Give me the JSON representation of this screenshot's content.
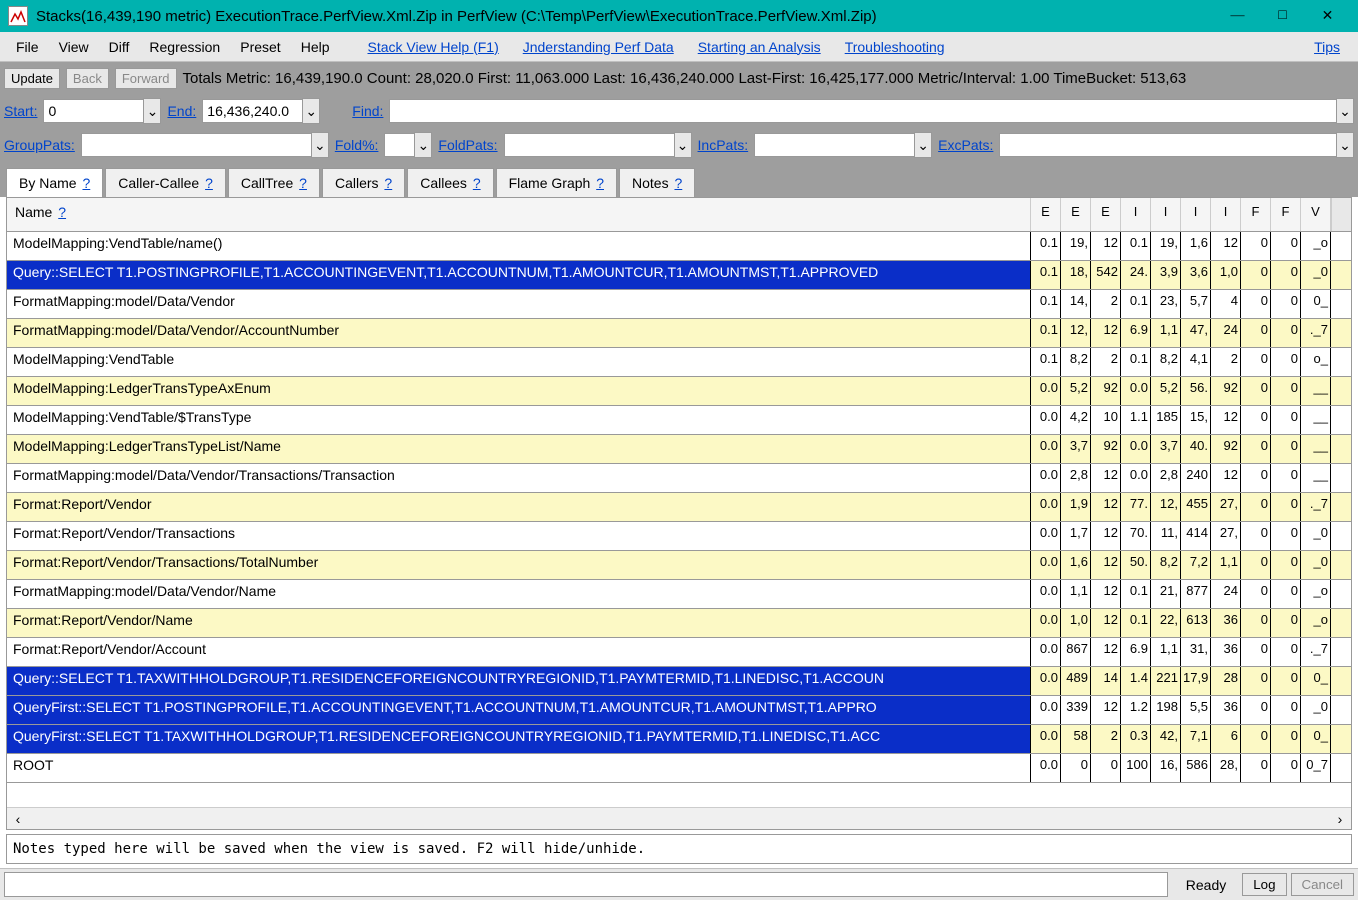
{
  "titlebar": {
    "title": "Stacks(16,439,190 metric) ExecutionTrace.PerfView.Xml.Zip in PerfView (C:\\Temp\\PerfView\\ExecutionTrace.PerfView.Xml.Zip)"
  },
  "menu": {
    "file": "File",
    "view": "View",
    "diff": "Diff",
    "regression": "Regression",
    "preset": "Preset",
    "help": "Help",
    "link_stack_view_help": "Stack View Help (F1)",
    "link_understanding": "Jnderstanding Perf Data",
    "link_starting": "Starting an Analysis",
    "link_troubleshooting": "Troubleshooting",
    "link_tips": "Tips"
  },
  "toolbar1": {
    "update": "Update",
    "back": "Back",
    "forward": "Forward",
    "totals": "Totals Metric: 16,439,190.0  Count: 28,020.0  First: 11,063.000 Last: 16,436,240.000  Last-First: 16,425,177.000  Metric/Interval: 1.00  TimeBucket: 513,63"
  },
  "toolbar2": {
    "start_label": "Start:",
    "start_value": "0",
    "end_label": "End:",
    "end_value": "16,436,240.0",
    "find_label": "Find:",
    "find_value": ""
  },
  "toolbar3": {
    "grouppats_label": "GroupPats:",
    "foldpct_label": "Fold%:",
    "foldpats_label": "FoldPats:",
    "incpats_label": "IncPats:",
    "excpats_label": "ExcPats:"
  },
  "tabs": {
    "byname": "By Name",
    "callercallee": "Caller-Callee",
    "calltree": "CallTree",
    "callers": "Callers",
    "callees": "Callees",
    "flamegraph": "Flame Graph",
    "notes": "Notes",
    "help": "?"
  },
  "table": {
    "col_name": "Name",
    "col_help": "?",
    "cols": [
      "E",
      "E",
      "E",
      "I",
      "I",
      "I",
      "I",
      "F",
      "F",
      "V"
    ],
    "rows": [
      {
        "name": "ModelMapping:VendTable/name()",
        "cells": [
          "0.1",
          "19,",
          "12",
          "0.1",
          "19,",
          "1,6",
          "12",
          "0",
          "0",
          "_o"
        ],
        "alt": false,
        "hl": false
      },
      {
        "name": "Query::SELECT T1.POSTINGPROFILE,T1.ACCOUNTINGEVENT,T1.ACCOUNTNUM,T1.AMOUNTCUR,T1.AMOUNTMST,T1.APPROVED",
        "cells": [
          "0.1",
          "18,",
          "542",
          "24.",
          "3,9",
          "3,6",
          "1,0",
          "0",
          "0",
          "_0"
        ],
        "alt": true,
        "hl": true
      },
      {
        "name": "FormatMapping:model/Data/Vendor",
        "cells": [
          "0.1",
          "14,",
          "2",
          "0.1",
          "23,",
          "5,7",
          "4",
          "0",
          "0",
          "0_"
        ],
        "alt": false,
        "hl": false
      },
      {
        "name": "FormatMapping:model/Data/Vendor/AccountNumber",
        "cells": [
          "0.1",
          "12,",
          "12",
          "6.9",
          "1,1",
          "47,",
          "24",
          "0",
          "0",
          "._7"
        ],
        "alt": true,
        "hl": false
      },
      {
        "name": "ModelMapping:VendTable",
        "cells": [
          "0.1",
          "8,2",
          "2",
          "0.1",
          "8,2",
          "4,1",
          "2",
          "0",
          "0",
          "o_"
        ],
        "alt": false,
        "hl": false
      },
      {
        "name": "ModelMapping:LedgerTransTypeAxEnum",
        "cells": [
          "0.0",
          "5,2",
          "92",
          "0.0",
          "5,2",
          "56.",
          "92",
          "0",
          "0",
          "__"
        ],
        "alt": true,
        "hl": false
      },
      {
        "name": "ModelMapping:VendTable/$TransType",
        "cells": [
          "0.0",
          "4,2",
          "10",
          "1.1",
          "185",
          "15,",
          "12",
          "0",
          "0",
          "__"
        ],
        "alt": false,
        "hl": false
      },
      {
        "name": "ModelMapping:LedgerTransTypeList/Name",
        "cells": [
          "0.0",
          "3,7",
          "92",
          "0.0",
          "3,7",
          "40.",
          "92",
          "0",
          "0",
          "__"
        ],
        "alt": true,
        "hl": false
      },
      {
        "name": "FormatMapping:model/Data/Vendor/Transactions/Transaction",
        "cells": [
          "0.0",
          "2,8",
          "12",
          "0.0",
          "2,8",
          "240",
          "12",
          "0",
          "0",
          "__"
        ],
        "alt": false,
        "hl": false
      },
      {
        "name": "Format:Report/Vendor",
        "cells": [
          "0.0",
          "1,9",
          "12",
          "77.",
          "12,",
          "455",
          "27,",
          "0",
          "0",
          "._7"
        ],
        "alt": true,
        "hl": false
      },
      {
        "name": "Format:Report/Vendor/Transactions",
        "cells": [
          "0.0",
          "1,7",
          "12",
          "70.",
          "11,",
          "414",
          "27,",
          "0",
          "0",
          "_0"
        ],
        "alt": false,
        "hl": false
      },
      {
        "name": "Format:Report/Vendor/Transactions/TotalNumber",
        "cells": [
          "0.0",
          "1,6",
          "12",
          "50.",
          "8,2",
          "7,2",
          "1,1",
          "0",
          "0",
          "_0"
        ],
        "alt": true,
        "hl": false
      },
      {
        "name": "FormatMapping:model/Data/Vendor/Name",
        "cells": [
          "0.0",
          "1,1",
          "12",
          "0.1",
          "21,",
          "877",
          "24",
          "0",
          "0",
          "_o"
        ],
        "alt": false,
        "hl": false
      },
      {
        "name": "Format:Report/Vendor/Name",
        "cells": [
          "0.0",
          "1,0",
          "12",
          "0.1",
          "22,",
          "613",
          "36",
          "0",
          "0",
          "_o"
        ],
        "alt": true,
        "hl": false
      },
      {
        "name": "Format:Report/Vendor/Account",
        "cells": [
          "0.0",
          "867",
          "12",
          "6.9",
          "1,1",
          "31,",
          "36",
          "0",
          "0",
          "._7"
        ],
        "alt": false,
        "hl": false
      },
      {
        "name": "Query::SELECT T1.TAXWITHHOLDGROUP,T1.RESIDENCEFOREIGNCOUNTRYREGIONID,T1.PAYMTERMID,T1.LINEDISC,T1.ACCOUN",
        "cells": [
          "0.0",
          "489",
          "14",
          "1.4",
          "221",
          "17,9",
          "28",
          "0",
          "0",
          "0_"
        ],
        "alt": true,
        "hl": true
      },
      {
        "name": "QueryFirst::SELECT T1.POSTINGPROFILE,T1.ACCOUNTINGEVENT,T1.ACCOUNTNUM,T1.AMOUNTCUR,T1.AMOUNTMST,T1.APPRO",
        "cells": [
          "0.0",
          "339",
          "12",
          "1.2",
          "198",
          "5,5",
          "36",
          "0",
          "0",
          "_0"
        ],
        "alt": false,
        "hl": true
      },
      {
        "name": "QueryFirst::SELECT T1.TAXWITHHOLDGROUP,T1.RESIDENCEFOREIGNCOUNTRYREGIONID,T1.PAYMTERMID,T1.LINEDISC,T1.ACC",
        "cells": [
          "0.0",
          "58",
          "2",
          "0.3",
          "42,",
          "7,1",
          "6",
          "0",
          "0",
          "0_"
        ],
        "alt": true,
        "hl": true
      },
      {
        "name": "ROOT",
        "cells": [
          "0.0",
          "0",
          "0",
          "100",
          "16,",
          "586",
          "28,",
          "0",
          "0",
          "0_7"
        ],
        "alt": false,
        "hl": false
      }
    ]
  },
  "notes": {
    "placeholder": "Notes typed here will be saved when the view is saved. F2 will hide/unhide."
  },
  "statusbar": {
    "ready": "Ready",
    "log": "Log",
    "cancel": "Cancel"
  }
}
